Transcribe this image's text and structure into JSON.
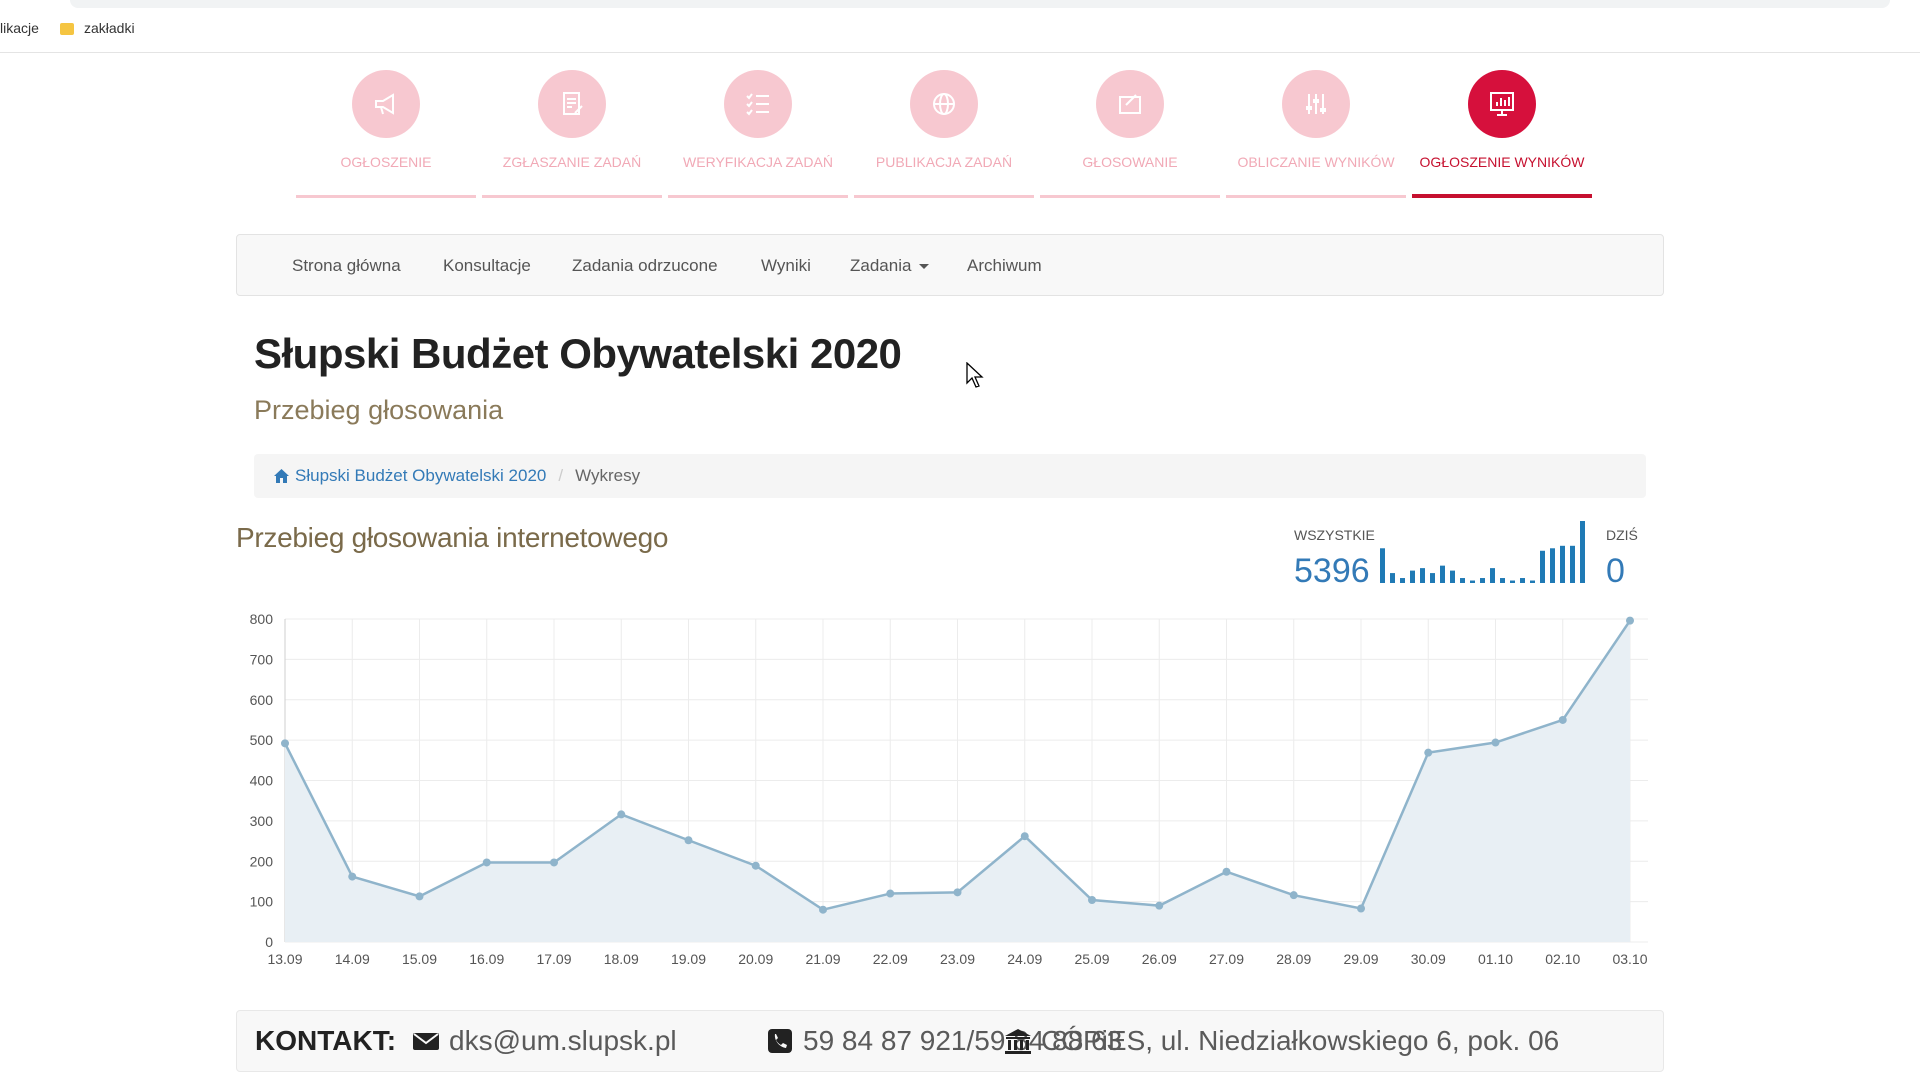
{
  "browser": {
    "bookmarks": [
      "likacje",
      "zakładki"
    ]
  },
  "steps": [
    {
      "label": "OGŁOSZENIE",
      "icon": "megaphone-icon",
      "active": false
    },
    {
      "label": "ZGŁASZANIE ZADAŃ",
      "icon": "document-pen-icon",
      "active": false
    },
    {
      "label": "WERYFIKACJA ZADAŃ",
      "icon": "checklist-icon",
      "active": false
    },
    {
      "label": "PUBLIKACJA ZADAŃ",
      "icon": "globe-icon",
      "active": false
    },
    {
      "label": "GŁOSOWANIE",
      "icon": "ballot-icon",
      "active": false
    },
    {
      "label": "OBLICZANIE WYNIKÓW",
      "icon": "equalizer-icon",
      "active": false
    },
    {
      "label": "OGŁOSZENIE WYNIKÓW",
      "icon": "results-chart-icon",
      "active": true
    }
  ],
  "nav": {
    "items": [
      "Strona główna",
      "Konsultacje",
      "Zadania odrzucone",
      "Wyniki",
      "Zadania",
      "Archiwum"
    ]
  },
  "page": {
    "title": "Słupski Budżet Obywatelski 2020",
    "subtitle": "Przebieg głosowania"
  },
  "breadcrumb": {
    "home": "Słupski Budżet Obywatelski 2020",
    "current": "Wykresy"
  },
  "chart_header": {
    "title": "Przebieg głosowania internetowego",
    "all_label": "WSZYSTKIE",
    "all_value": "5396",
    "today_label": "DZIŚ",
    "today_value": "0"
  },
  "colors": {
    "accent": "#c6102f",
    "step_inactive": "#f7c8d0",
    "link": "#337ab7",
    "line": "#8fb4cb",
    "area": "#e8eff4"
  },
  "chart_data": {
    "type": "area",
    "x": [
      "13.09",
      "14.09",
      "15.09",
      "16.09",
      "17.09",
      "18.09",
      "19.09",
      "20.09",
      "21.09",
      "22.09",
      "23.09",
      "24.09",
      "25.09",
      "26.09",
      "27.09",
      "28.09",
      "29.09",
      "30.09",
      "01.10",
      "02.10",
      "03.10"
    ],
    "series": [
      {
        "values": [
          492,
          162,
          113,
          197,
          197,
          316,
          252,
          189,
          80,
          120,
          123,
          262,
          104,
          90,
          174,
          116,
          83,
          469,
          494,
          550,
          796
        ]
      }
    ],
    "ylim": [
      0,
      800
    ],
    "yticks": [
      0,
      100,
      200,
      300,
      400,
      500,
      600,
      700,
      800
    ],
    "grid": true
  },
  "sparkline_data": {
    "values": [
      28,
      8,
      4,
      10,
      12,
      8,
      14,
      10,
      4,
      2,
      4,
      12,
      4,
      2,
      4,
      2,
      26,
      28,
      30,
      30,
      50
    ]
  },
  "footer": {
    "label": "KONTAKT:",
    "email": "dks@um.slupsk.pl",
    "phone": "59 84 87 921/59 84 88 63",
    "address": "CÓPiES, ul. Niedziałkowskiego 6, pok. 06"
  }
}
